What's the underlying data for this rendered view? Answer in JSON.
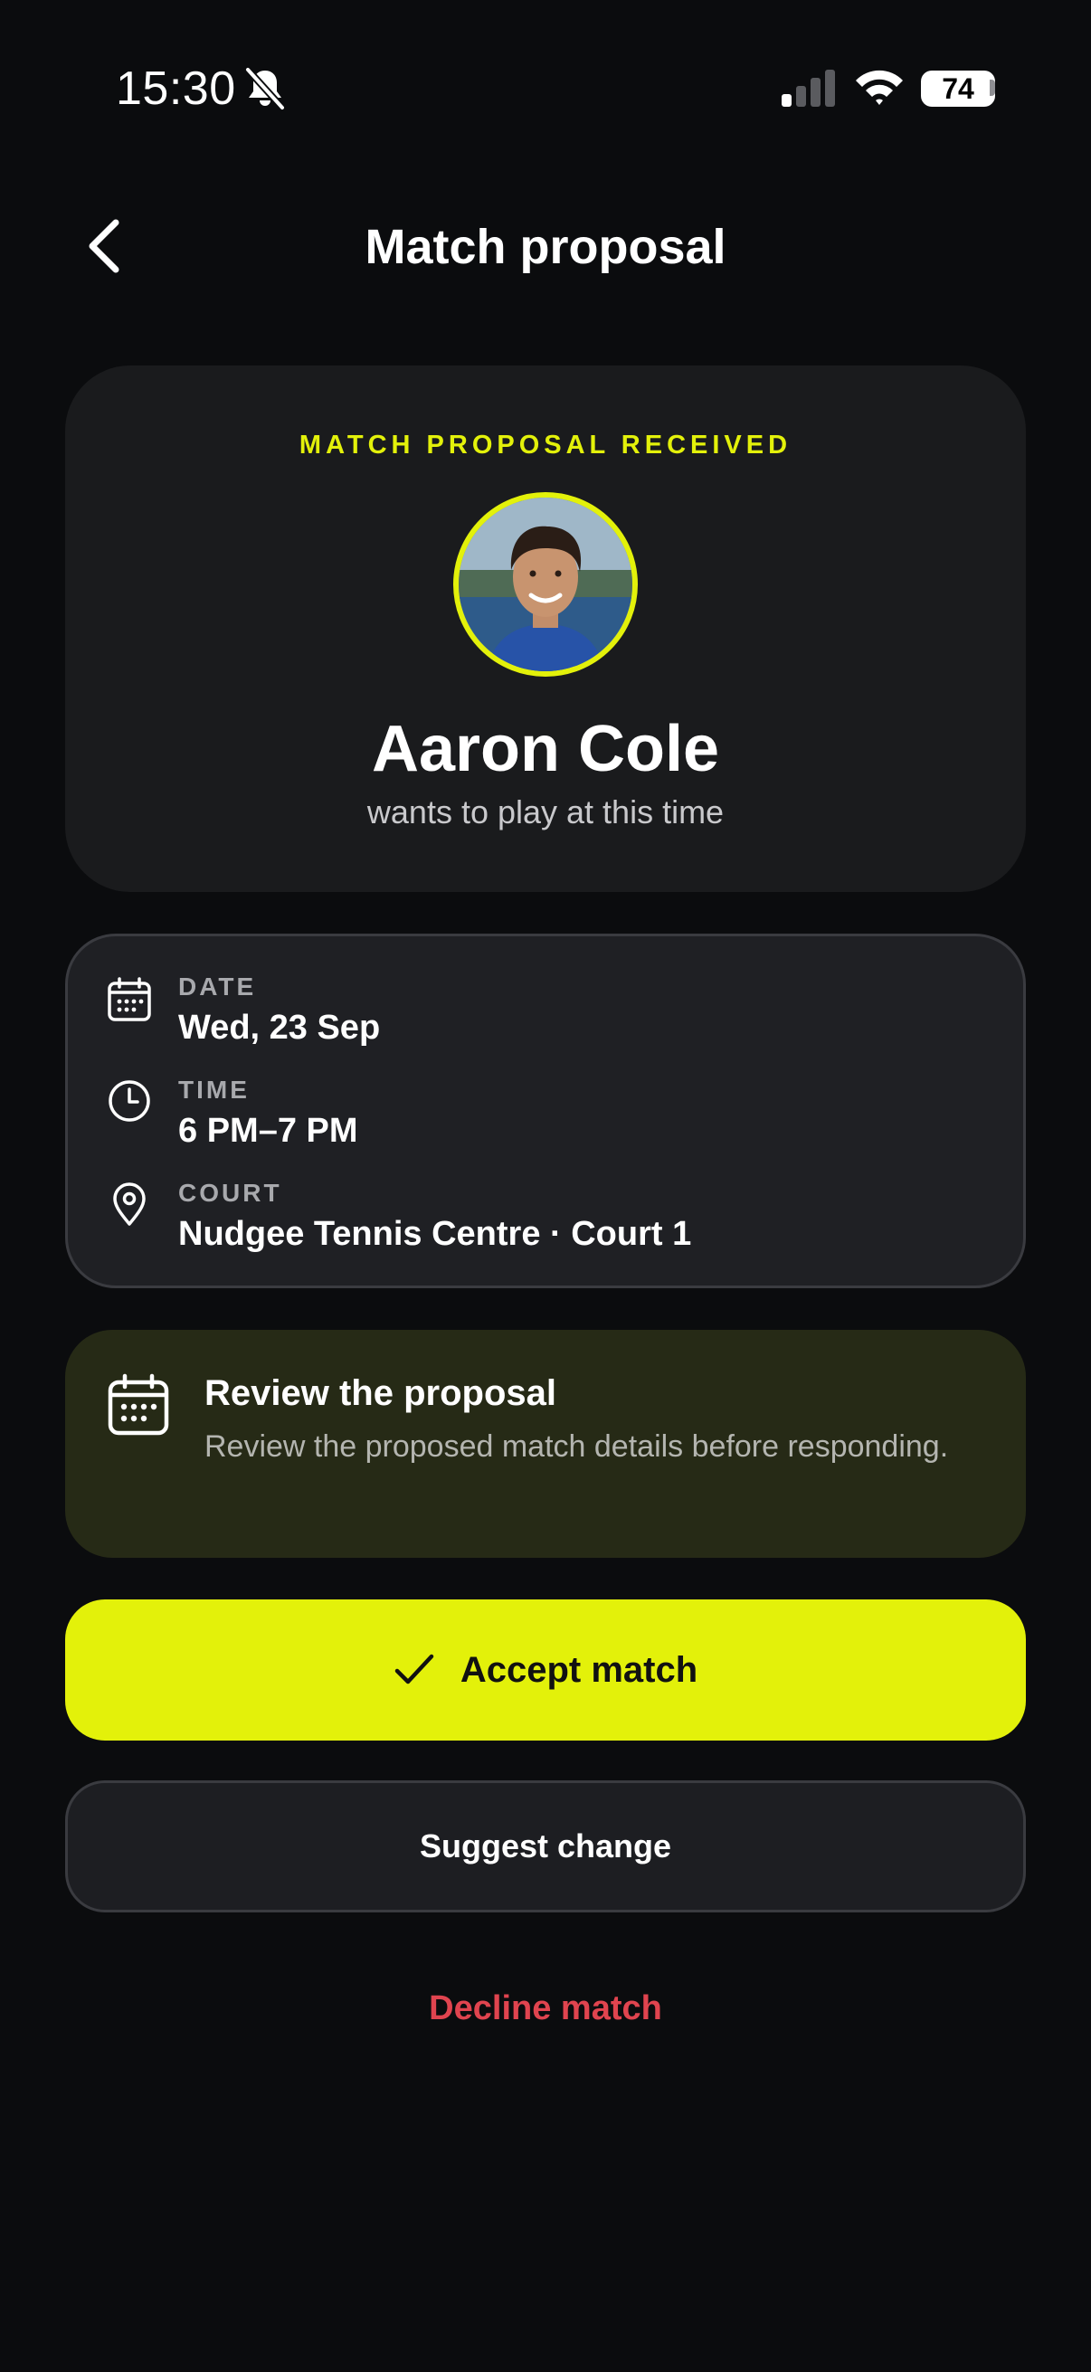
{
  "status_bar": {
    "time": "15:30",
    "battery": "74",
    "icons": [
      "bell-off-icon",
      "cellular-signal-icon",
      "wifi-icon",
      "battery-icon"
    ]
  },
  "nav": {
    "title": "Match proposal",
    "back_icon": "chevron-left-icon"
  },
  "proposal": {
    "label": "MATCH PROPOSAL RECEIVED",
    "player_name": "Aaron Cole",
    "subtitle": "wants to play at this time"
  },
  "details": {
    "date_label": "DATE",
    "date_value": "Wed, 23 Sep",
    "time_label": "TIME",
    "time_value": "6 PM–7 PM",
    "court_label": "COURT",
    "court_value": "Nudgee Tennis Centre · Court 1"
  },
  "info": {
    "title": "Review the proposal",
    "text": "Review the proposed match details before responding."
  },
  "actions": {
    "accept": "Accept match",
    "suggest": "Suggest change",
    "decline": "Decline match"
  },
  "colors": {
    "accent": "#e3f10a",
    "background": "#0b0c0e",
    "danger": "#e0444f"
  }
}
